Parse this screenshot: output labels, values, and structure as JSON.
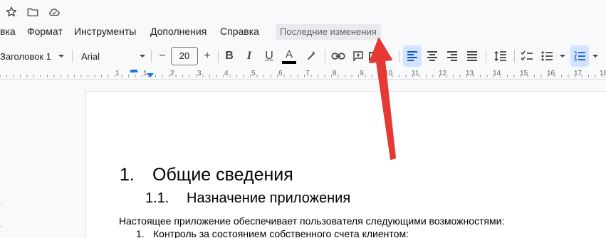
{
  "menubar": {
    "items": [
      "вка",
      "Формат",
      "Инструменты",
      "Дополнения",
      "Справка"
    ],
    "last_edit": "Последние изменения"
  },
  "toolbar": {
    "style": "Заголовок 1",
    "font": "Arial",
    "font_size": "20",
    "minus": "−",
    "plus": "+",
    "bold": "B",
    "italic": "I",
    "underline": "U",
    "text_color": "A",
    "text_color_hex": "#000000"
  },
  "ruler": {
    "numbers": [
      "1",
      "1",
      "2",
      "3",
      "4",
      "5",
      "6",
      "7",
      "8",
      "9",
      "10",
      "11",
      "12",
      "13",
      "14",
      "15",
      "16",
      "17",
      "18"
    ]
  },
  "document": {
    "h1_number": "1.",
    "h1_text": "Общие сведения",
    "h2_number": "1.1.",
    "h2_text": "Назначение приложения",
    "paragraph": "Настоящее приложение обеспечивает пользователя следующими возможностями:",
    "list_item_number": "1.",
    "list_item_text": "Контроль за состоянием собственного счета клиентом:"
  },
  "colors": {
    "arrow": "#e53935",
    "accent": "#0b57d0"
  }
}
